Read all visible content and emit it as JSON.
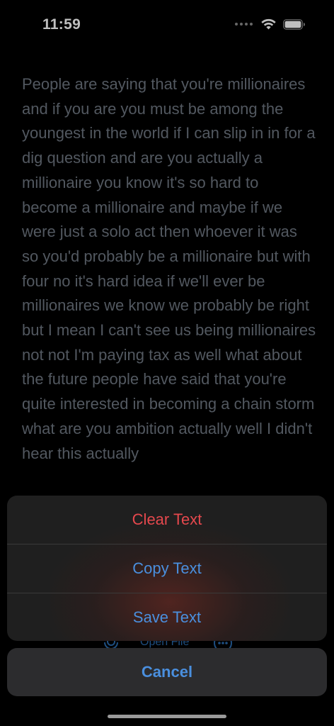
{
  "status_bar": {
    "time": "11:59",
    "icons": [
      "signal-dots-icon",
      "wifi-icon",
      "battery-icon"
    ]
  },
  "transcript": {
    "text": "People are saying that you're millionaires and if you are you must be among the youngest in the world if I can slip in in for a dig question and are you actually a millionaire you know it's so hard to become a millionaire and maybe if we were just a solo act then whoever it was so you'd probably be a millionaire but with four no it's hard idea if we'll ever be millionaires we know we probably be right but I mean I can't see us being millionaires not not I'm paying tax as well what about the future people have said that you're quite interested in becoming a chain storm what are you ambition actually well I didn't hear this actually"
  },
  "toolbar": {
    "open_file_label": "Open File",
    "icons": [
      "microphone-icon",
      "more-icon"
    ]
  },
  "action_sheet": {
    "clear_label": "Clear Text",
    "copy_label": "Copy Text",
    "save_label": "Save Text",
    "cancel_label": "Cancel"
  },
  "colors": {
    "destructive": "#e5484d",
    "accent": "#4a8fde",
    "background": "#000000"
  }
}
